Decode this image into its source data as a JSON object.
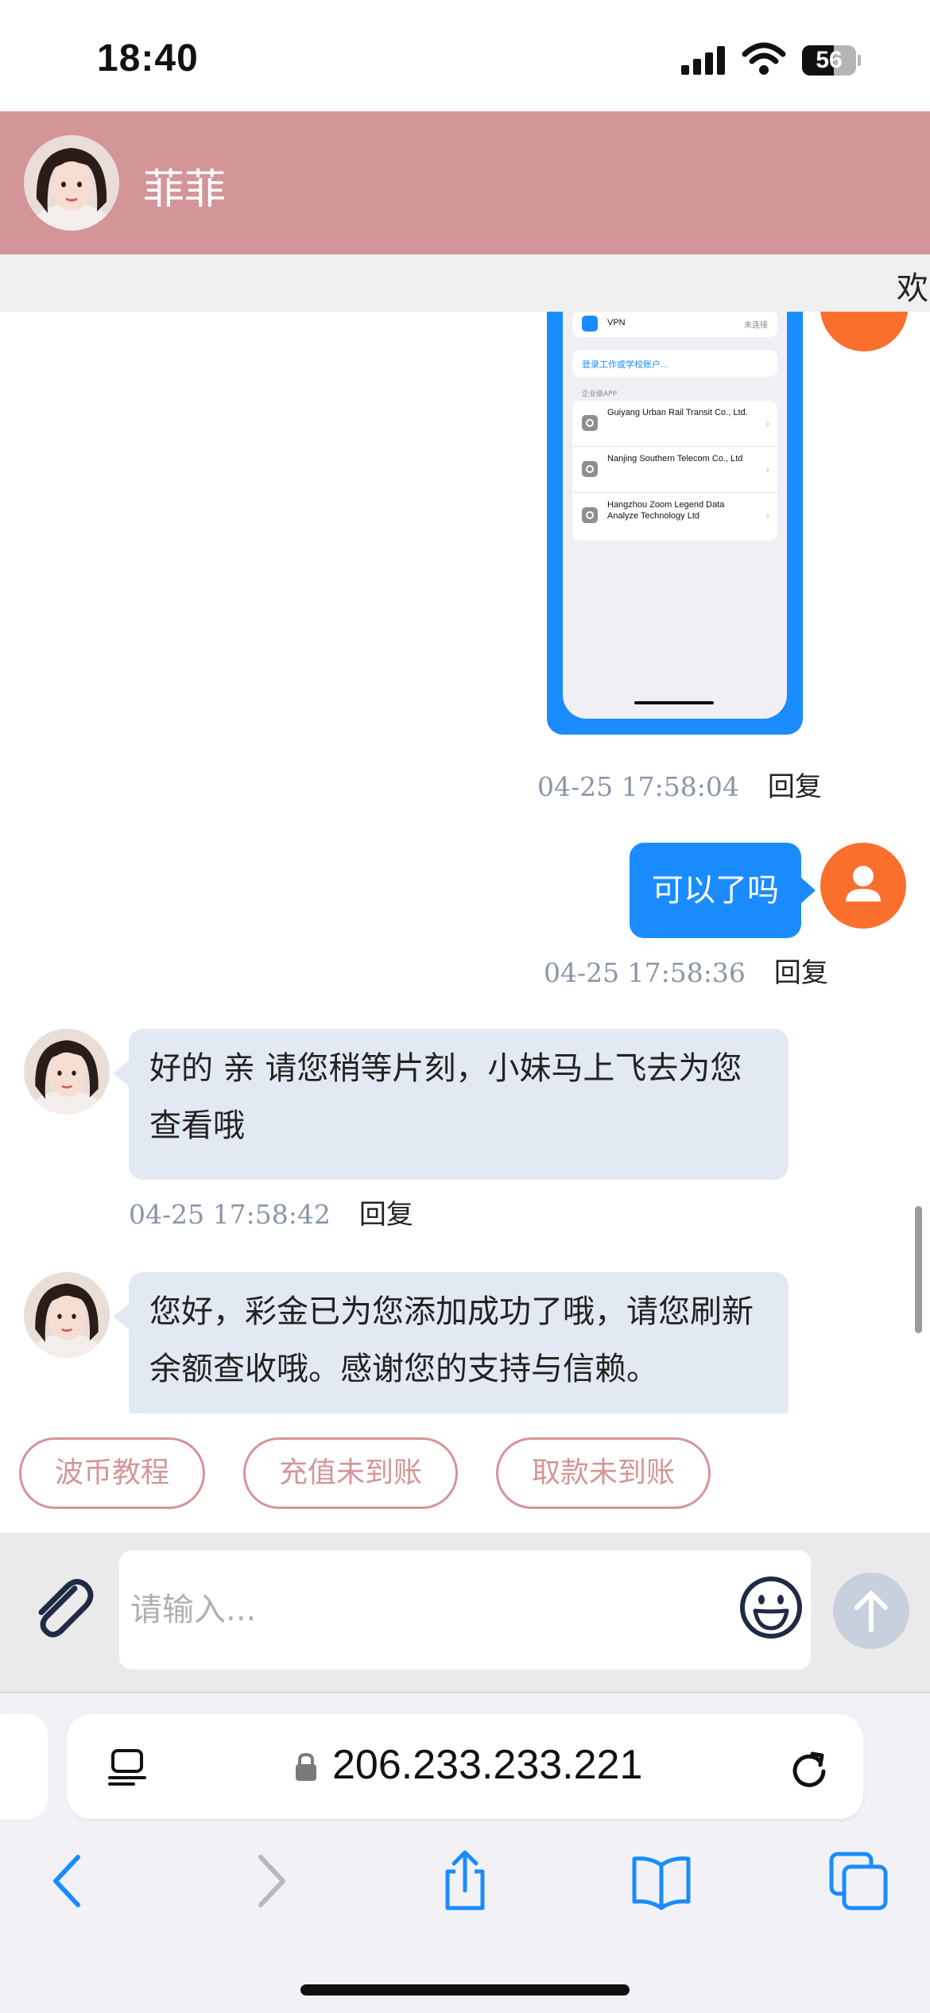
{
  "status_bar": {
    "time": "18:40",
    "battery": "56",
    "icons": [
      "cellular-signal-icon",
      "wifi-icon",
      "battery-icon"
    ]
  },
  "header": {
    "contact_name": "菲菲",
    "marquee": "欢"
  },
  "shared_screenshot": {
    "vpn_label": "VPN",
    "vpn_status": "未连接",
    "login_link": "登录工作或学校账户...",
    "section_title": "企业级APP",
    "apps": [
      "Guiyang Urban Rail Transit Co., Ltd.",
      "Nanjing Southern Telecom Co., Ltd",
      "Hangzhou Zoom Legend Data Analyze Technology Ltd"
    ]
  },
  "messages": [
    {
      "from": "user",
      "type": "image",
      "time": "04-25 17:58:04",
      "reply": "回复"
    },
    {
      "from": "user",
      "type": "text",
      "text": "可以了吗",
      "time": "04-25 17:58:36",
      "reply": "回复"
    },
    {
      "from": "agent",
      "type": "text",
      "text": "好的 亲 请您稍等片刻，小妹马上飞去为您查看哦",
      "time": "04-25 17:58:42",
      "reply": "回复"
    },
    {
      "from": "agent",
      "type": "text",
      "text": "您好，彩金已为您添加成功了哦，请您刷新余额查收哦。感谢您的支持与信赖。"
    }
  ],
  "quick_replies": [
    "波币教程",
    "充值未到账",
    "取款未到账"
  ],
  "composer": {
    "placeholder": "请输入..."
  },
  "browser": {
    "url": "206.233.233.221"
  },
  "colors": {
    "header": "#d39598",
    "user_bubble": "#1a8cff",
    "agent_bubble": "#e2e9f3",
    "user_avatar": "#fb6f2d",
    "ios_blue": "#1a8cff"
  }
}
